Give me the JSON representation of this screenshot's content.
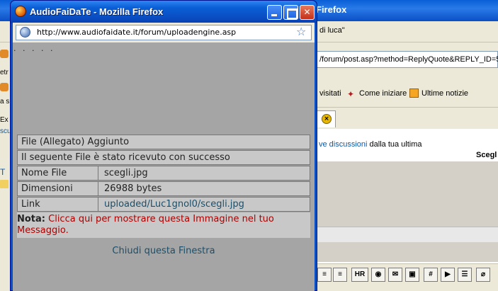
{
  "background_window": {
    "title": "Firefox",
    "url_fragment": "di luca\"",
    "address": "/forum/post.asp?method=ReplyQuote&REPLY_ID=50",
    "bookmarks": [
      "visitati",
      "Come iniziare",
      "Ultime notizie"
    ],
    "content_line_link": "ve discussioni",
    "content_line_text": " dalla tua ultima",
    "column_header": "Scegl",
    "toolbar_buttons": [
      "HR",
      "#"
    ],
    "left_labels": [
      "etr",
      "a s",
      "Ex",
      "scu",
      "T"
    ]
  },
  "popup": {
    "title": "AudioFaiDaTe - Mozilla Firefox",
    "url": "http://www.audiofaidate.it/forum/uploadengine.asp",
    "dots": ". . . . .",
    "table": {
      "header": "File (Allegato) Aggiunto",
      "message": "Il seguente File è stato ricevuto con successo",
      "rows": [
        {
          "label": "Nome File",
          "value": "scegli.jpg"
        },
        {
          "label": "Dimensioni",
          "value": "26988 bytes"
        },
        {
          "label": "Link",
          "value": "uploaded/Luc1gnol0/scegli.jpg"
        }
      ]
    },
    "note_label": "Nota:",
    "note_text": " Clicca qui per mostrare questa Immagine nel tuo Messaggio.",
    "close_link": "Chiudi questa Finestra"
  },
  "colors": {
    "titlebar": "#0a4fc4",
    "note_red": "#b00000",
    "link_teal": "#1a4f6b",
    "table_bg": "#c8c8c8",
    "body_bg": "#a5a5a5"
  },
  "icons": [
    "firefox-icon",
    "minimize-icon",
    "maximize-icon",
    "close-icon",
    "globe-icon",
    "star-icon"
  ]
}
